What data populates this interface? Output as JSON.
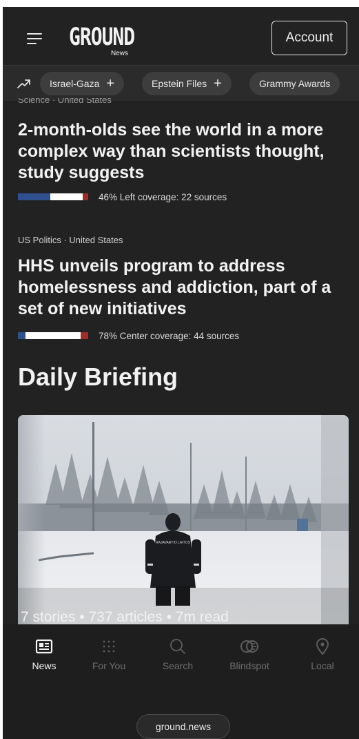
{
  "header": {
    "logo_text": "GROUND",
    "logo_sub": "News",
    "account_label": "Account"
  },
  "topics": [
    {
      "label": "Israel-Gaza",
      "has_plus": true
    },
    {
      "label": "Epstein Files",
      "has_plus": true
    },
    {
      "label": "Grammy Awards",
      "has_plus": false
    }
  ],
  "feed": {
    "partial_category": "Science · United States",
    "articles": [
      {
        "category": "",
        "title": "2-month-olds see the world in a more complex way than scientists thought, study suggests",
        "bias_text": "46% Left coverage: 22 sources",
        "bias": {
          "left": 0.46,
          "center": 0.46,
          "right": 0.08
        }
      },
      {
        "category": "US Politics · United States",
        "title": "HHS unveils program to address homelessness and addiction, part of a set of new initiatives",
        "bias_text": "78% Center coverage: 44 sources",
        "bias": {
          "left": 0.11,
          "center": 0.78,
          "right": 0.11
        }
      }
    ]
  },
  "briefing": {
    "title": "Daily Briefing",
    "meta": "7 stories • 737 articles • 7m read",
    "jacket_text": "RAJAVARTIO LAITOS"
  },
  "bottom_nav": {
    "items": [
      {
        "label": "News",
        "icon": "newspaper-icon",
        "active": true
      },
      {
        "label": "For You",
        "icon": "grid-dots-icon",
        "active": false
      },
      {
        "label": "Search",
        "icon": "search-icon",
        "active": false
      },
      {
        "label": "Blindspot",
        "icon": "blindspot-icon",
        "active": false
      },
      {
        "label": "Local",
        "icon": "location-pin-icon",
        "active": false
      }
    ]
  },
  "browser": {
    "url": "ground.news"
  },
  "colors": {
    "background": "#222222",
    "bias_left": "#2f4f8f",
    "bias_center": "#ffffff",
    "bias_right": "#a32a2a",
    "nav_active": "#f2f2f2",
    "nav_inactive": "#6e6e6e"
  }
}
